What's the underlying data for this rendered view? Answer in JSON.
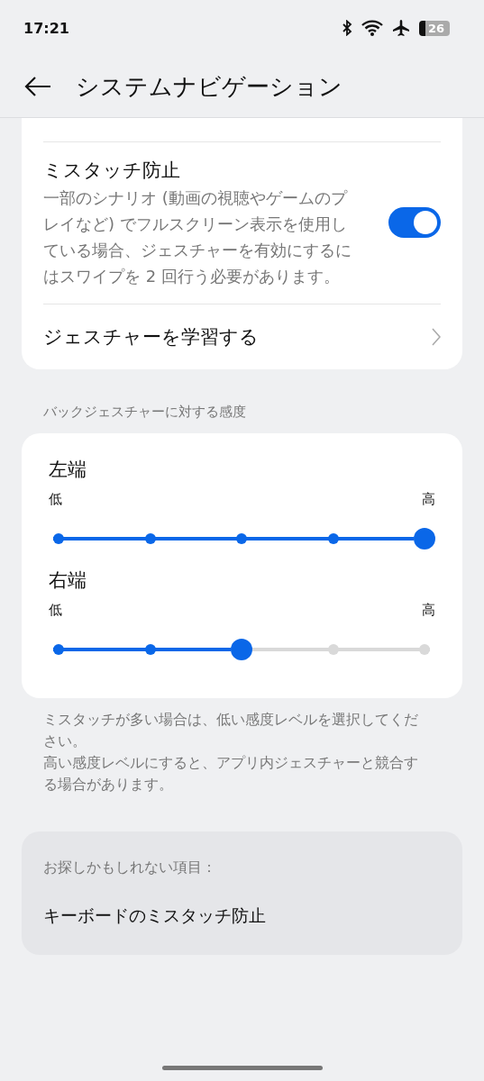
{
  "status_bar": {
    "time": "17:21",
    "battery": "26"
  },
  "header": {
    "title": "システムナビゲーション"
  },
  "settings": [
    {
      "kind": "toggle",
      "title": "ミスタッチ防止",
      "description": "一部のシナリオ (動画の視聴やゲームのプレイなど) でフルスクリーン表示を使用している場合、ジェスチャーを有効にするにはスワイプを 2 回行う必要があります。",
      "on": true
    },
    {
      "kind": "link",
      "title": "ジェスチャーを学習する"
    }
  ],
  "sensitivity": {
    "label": "バックジェスチャーに対する感度",
    "sliders": [
      {
        "title": "左端",
        "low": "低",
        "high": "高",
        "level": 1
      },
      {
        "title": "右端",
        "low": "低",
        "high": "高",
        "level": 0.5
      }
    ],
    "notes": [
      "ミスタッチが多い場合は、低い感度レベルを選択してください。",
      "高い感度レベルにすると、アプリ内ジェスチャーと競合する場合があります。"
    ]
  },
  "suggestions": {
    "label": "お探しかもしれない項目：",
    "items": [
      "キーボードのミスタッチ防止"
    ]
  }
}
